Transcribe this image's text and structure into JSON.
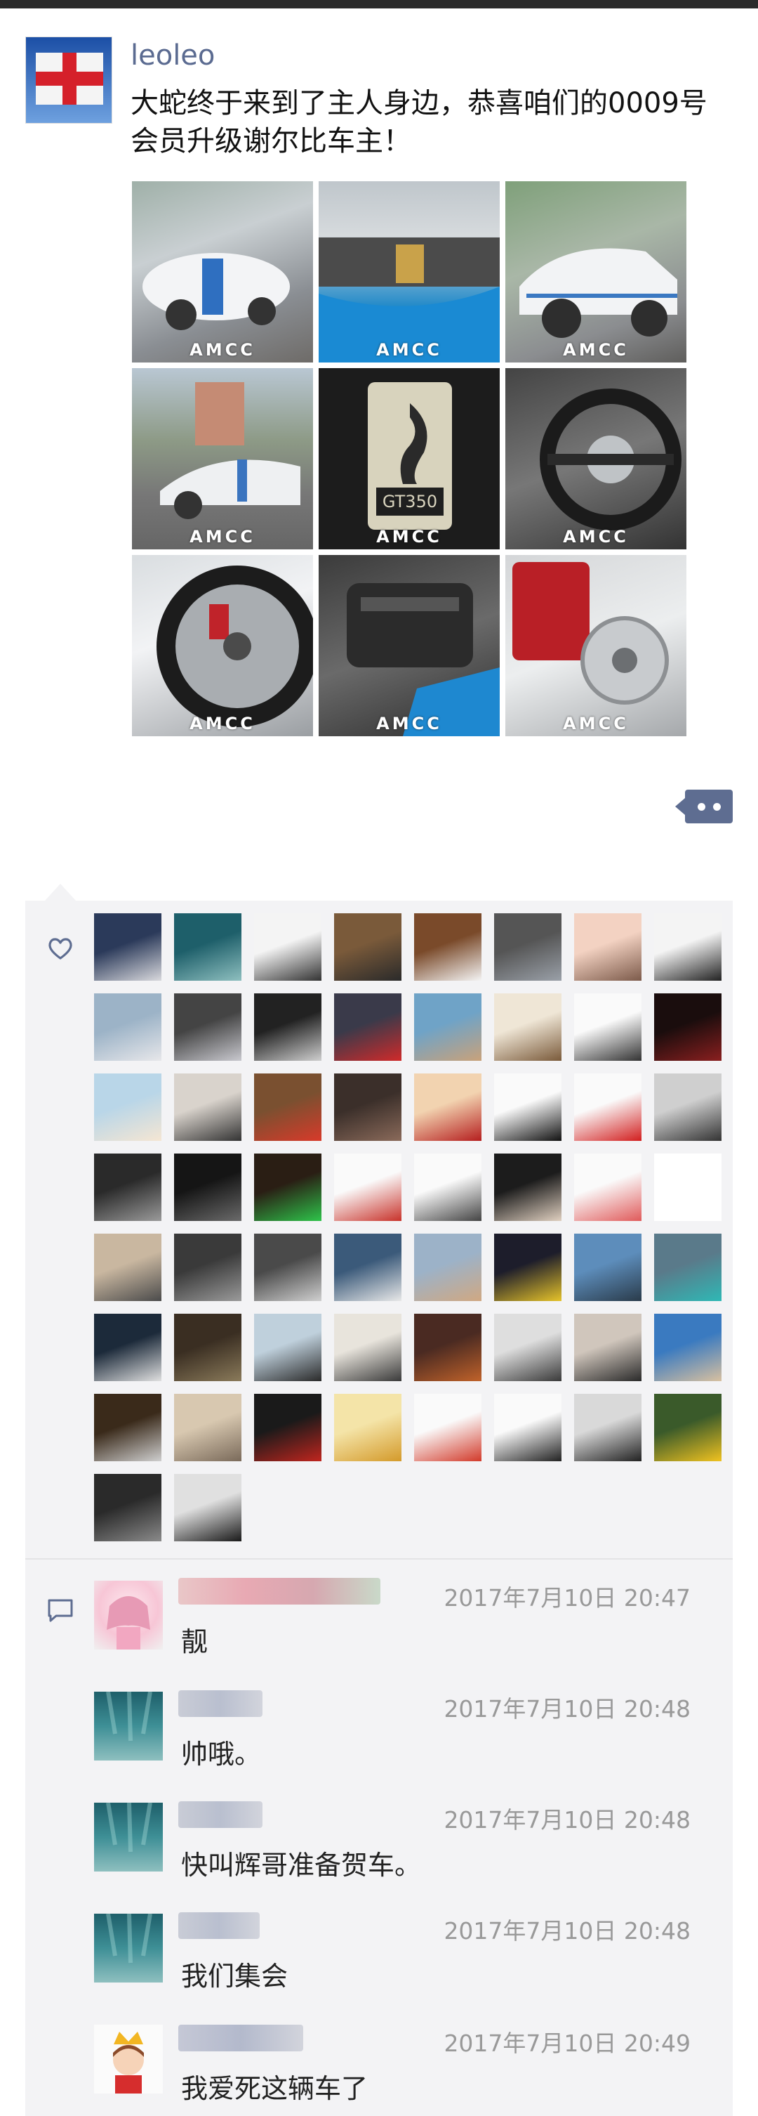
{
  "post": {
    "username": "leoleo",
    "text": "大蛇终于来到了主人身边，恭喜咱们的0009号会员升级谢尔比车主！",
    "watermark": "AMCC",
    "photos": [
      {
        "icon": "white-mustang-front-photo"
      },
      {
        "icon": "blue-stripe-hood-photo"
      },
      {
        "icon": "white-mustang-side-photo"
      },
      {
        "icon": "white-mustang-rear-photo"
      },
      {
        "icon": "shelby-cobra-gt350-floor-mat-photo"
      },
      {
        "icon": "steering-wheel-photo"
      },
      {
        "icon": "wheel-brake-caliper-photo"
      },
      {
        "icon": "engine-bay-photo"
      },
      {
        "icon": "red-caliper-rim-photo"
      }
    ]
  },
  "likes": {
    "icon": "heart-icon",
    "avatars": [
      "avatar-man-suit",
      "avatar-underwater",
      "avatar-ink-art",
      "avatar-couple-back",
      "avatar-basketball-player",
      "avatar-man-sunglasses",
      "avatar-couple-selfie",
      "avatar-corvette-logo",
      "avatar-seaside",
      "avatar-young-man",
      "avatar-grinning-cartoon",
      "avatar-red-car",
      "avatar-statue",
      "avatar-leon-logo",
      "avatar-bunny-cartoon",
      "avatar-dark-red",
      "avatar-bunny-girl",
      "avatar-hand-photo",
      "avatar-red-ferrari",
      "avatar-shoes",
      "avatar-girl-beach",
      "avatar-eyes-doodle",
      "avatar-number-two",
      "avatar-silhouette",
      "avatar-club-group",
      "avatar-man-dark",
      "avatar-motorbike",
      "avatar-haotaitai-card",
      "avatar-cat-doodle",
      "avatar-man-glasses",
      "avatar-pig-cartoon",
      "avatar-blank",
      "avatar-cat-sticker",
      "avatar-car-door",
      "avatar-group-vintage",
      "avatar-the-last-ship",
      "avatar-justin",
      "avatar-yellow-car",
      "avatar-pyramid",
      "avatar-muscle-car",
      "avatar-man-tattoo",
      "avatar-triangle-art",
      "avatar-man-cloud",
      "avatar-anime-boy",
      "avatar-painting",
      "avatar-man-street",
      "avatar-man-kitchen",
      "avatar-family",
      "avatar-black-car",
      "avatar-stone",
      "avatar-red-pattern",
      "avatar-doge",
      "avatar-red-fox",
      "avatar-cupid",
      "avatar-man-cap",
      "avatar-yellow-suv",
      "avatar-gun",
      "avatar-bw-man"
    ]
  },
  "comments": {
    "icon": "comment-icon",
    "items": [
      {
        "avatar": "avatar-pink-girl",
        "time": "2017年7月10日 20:47",
        "text": "靓"
      },
      {
        "avatar": "avatar-underwater",
        "time": "2017年7月10日 20:48",
        "text": "帅哦。"
      },
      {
        "avatar": "avatar-underwater",
        "time": "2017年7月10日 20:48",
        "text": "快叫辉哥准备贺车。"
      },
      {
        "avatar": "avatar-underwater",
        "time": "2017年7月10日 20:48",
        "text": "我们集会"
      },
      {
        "avatar": "avatar-prince-cartoon",
        "time": "2017年7月10日 20:49",
        "text": "我爱死这辆车了"
      }
    ]
  }
}
